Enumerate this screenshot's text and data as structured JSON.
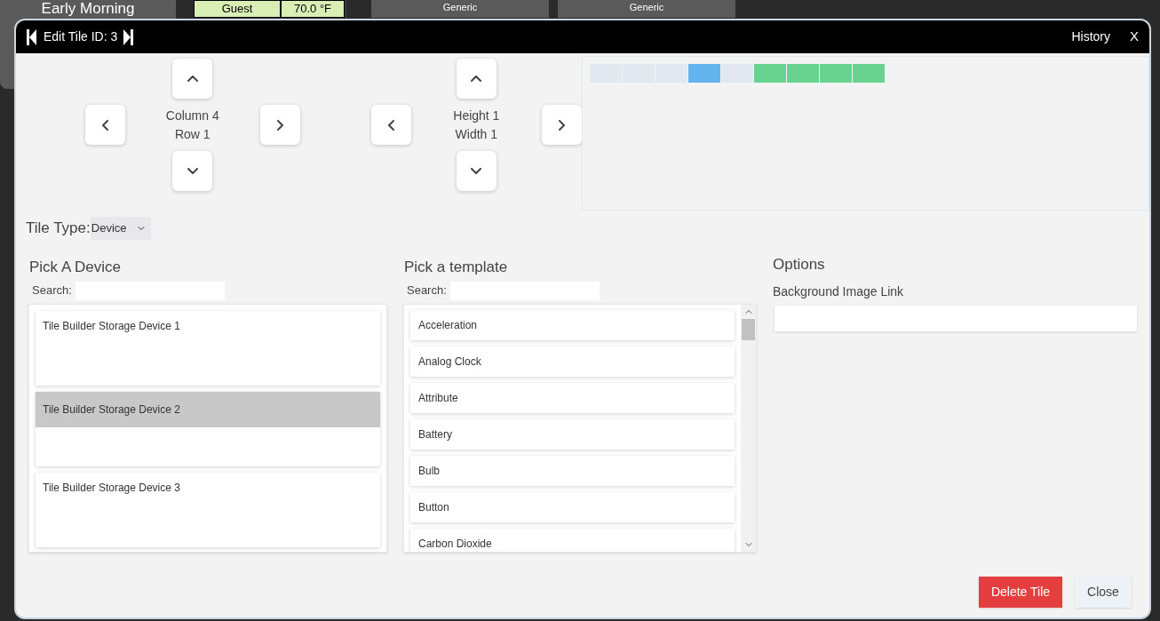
{
  "background": {
    "mode_tile": "Early Morning",
    "table_rows": [
      {
        "room": "Guest",
        "temp": "70.0 °F"
      }
    ],
    "generic_tiles": [
      "Generic",
      "Generic"
    ]
  },
  "dialog": {
    "title": "Edit Tile ID: 3",
    "history": "History",
    "close_x": "X",
    "position": {
      "lines": [
        "Column 4",
        "Row 1"
      ]
    },
    "size": {
      "lines": [
        "Height 1",
        "Width 1"
      ]
    },
    "preview_cells": [
      {
        "color": "#e2e8f0"
      },
      {
        "color": "#e2e8f0"
      },
      {
        "color": "#e2e8f0"
      },
      {
        "color": "#63b3ed"
      },
      {
        "color": "#e2e8f0"
      },
      {
        "color": "#68d391"
      },
      {
        "color": "#68d391"
      },
      {
        "color": "#68d391"
      },
      {
        "color": "#68d391"
      }
    ],
    "tile_type": {
      "label": "Tile Type:",
      "value": "Device"
    },
    "devices": {
      "title": "Pick A Device",
      "search_label": "Search:",
      "items": [
        {
          "label": "Tile Builder Storage Device 1",
          "selected": false
        },
        {
          "label": "Tile Builder Storage Device 2",
          "selected": true
        },
        {
          "label": "Tile Builder Storage Device 3",
          "selected": false
        }
      ]
    },
    "templates": {
      "title": "Pick a template",
      "search_label": "Search:",
      "items": [
        "Acceleration",
        "Analog Clock",
        "Attribute",
        "Battery",
        "Bulb",
        "Button",
        "Carbon Dioxide"
      ]
    },
    "options": {
      "title": "Options",
      "field_label": "Background Image Link"
    },
    "buttons": {
      "delete": "Delete Tile",
      "close": "Close"
    }
  }
}
